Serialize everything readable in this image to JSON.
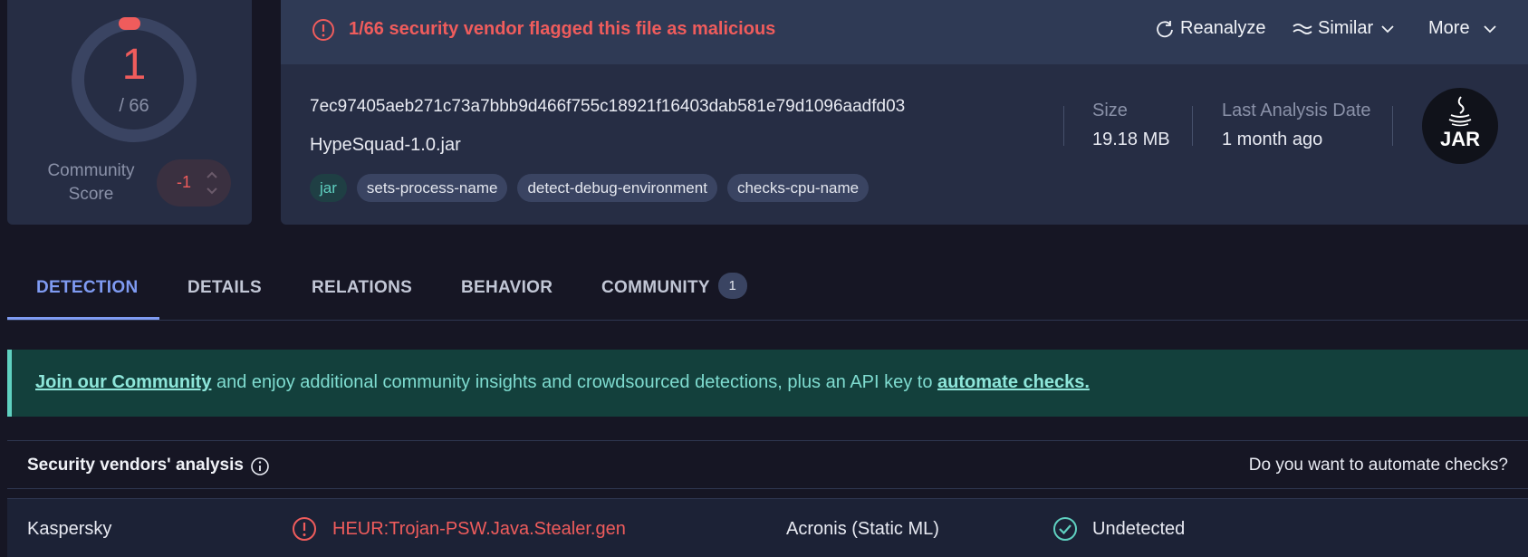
{
  "score": {
    "detections": "1",
    "total": "/ 66",
    "community_label": "Community Score",
    "community_value": "-1"
  },
  "alert": {
    "text": "1/66 security vendor flagged this file as malicious",
    "color": "#ef5c5c"
  },
  "actions": {
    "reanalyze": "Reanalyze",
    "similar": "Similar",
    "more": "More"
  },
  "file": {
    "hash": "7ec97405aeb271c73a7bbb9d466f755c18921f16403dab581e79d1096aadfd03",
    "name": "HypeSquad-1.0.jar",
    "tags": [
      "jar",
      "sets-process-name",
      "detect-debug-environment",
      "checks-cpu-name"
    ],
    "size_label": "Size",
    "size_value": "19.18 MB",
    "date_label": "Last Analysis Date",
    "date_value": "1 month ago",
    "type_icon_label": "JAR"
  },
  "tabs": [
    {
      "label": "DETECTION",
      "active": true
    },
    {
      "label": "DETAILS"
    },
    {
      "label": "RELATIONS"
    },
    {
      "label": "BEHAVIOR"
    },
    {
      "label": "COMMUNITY",
      "badge": "1"
    }
  ],
  "banner": {
    "link1": "Join our Community",
    "middle": " and enjoy additional community insights and crowdsourced detections, plus an API key to ",
    "link2": "automate checks."
  },
  "vendors": {
    "title": "Security vendors' analysis",
    "automate_question": "Do you want to automate checks?",
    "rows": [
      {
        "left_vendor": "Kaspersky",
        "left_result": "HEUR:Trojan-PSW.Java.Stealer.gen",
        "right_vendor": "Acronis (Static ML)",
        "right_result": "Undetected"
      }
    ]
  },
  "colors": {
    "background": "#161624",
    "card": "#262d44",
    "malicious": "#ef5c5c",
    "accent": "#7f9bf2",
    "community": "#5fd0c0"
  }
}
